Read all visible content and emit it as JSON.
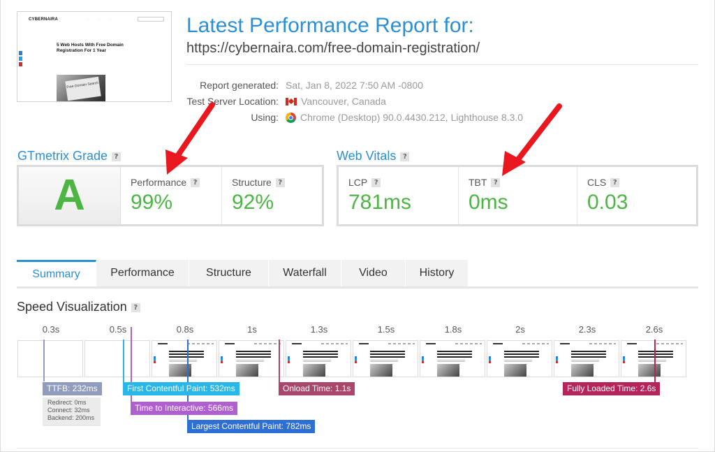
{
  "report": {
    "title": "Latest Performance Report for:",
    "url": "https://cybernaira.com/free-domain-registration/",
    "meta": [
      {
        "label": "Report generated:",
        "value": "Sat, Jan 8, 2022 7:50 AM -0800"
      },
      {
        "label": "Test Server Location:",
        "value": "Vancouver, Canada"
      },
      {
        "label": "Using:",
        "value": "Chrome (Desktop) 90.0.4430.212, Lighthouse 8.3.0"
      }
    ]
  },
  "thumbnail": {
    "logo": "CYBERNAIRA",
    "headline": "5 Web Hosts With Free Domain Registration For 1 Year",
    "paper_text": "Free Domain Search"
  },
  "grade": {
    "section_title": "GTmetrix Grade",
    "letter": "A",
    "performance_label": "Performance",
    "performance_value": "99%",
    "structure_label": "Structure",
    "structure_value": "92%"
  },
  "vitals": {
    "section_title": "Web Vitals",
    "lcp_label": "LCP",
    "lcp_value": "781ms",
    "tbt_label": "TBT",
    "tbt_value": "0ms",
    "cls_label": "CLS",
    "cls_value": "0.03"
  },
  "help_glyph": "?",
  "tabs": [
    "Summary",
    "Performance",
    "Structure",
    "Waterfall",
    "Video",
    "History"
  ],
  "speed": {
    "title": "Speed Visualization",
    "ticks": [
      "0.3s",
      "0.5s",
      "0.8s",
      "1s",
      "1.3s",
      "1.5s",
      "1.8s",
      "2s",
      "2.3s",
      "2.6s"
    ],
    "markers": {
      "ttfb": "TTFB: 232ms",
      "fcp": "First Contentful Paint: 532ms",
      "tti": "Time to Interactive: 566ms",
      "lcp": "Largest Contentful Paint: 782ms",
      "onload": "Onload Time: 1.1s",
      "fully": "Fully Loaded Time: 2.6s"
    },
    "ttfb_breakdown": {
      "redirect": "Redirect: 0ms",
      "connect": "Connect: 32ms",
      "backend": "Backend: 200ms"
    }
  },
  "colors": {
    "accent": "#2b8fd6",
    "good": "#4cb543",
    "arrow": "#e8181e",
    "ttfb": "#8f9cbd",
    "fcp": "#29b6e8",
    "tti": "#b05fcf",
    "lcp": "#2e6fd6",
    "onload": "#a8466b",
    "fully": "#b5245a"
  }
}
